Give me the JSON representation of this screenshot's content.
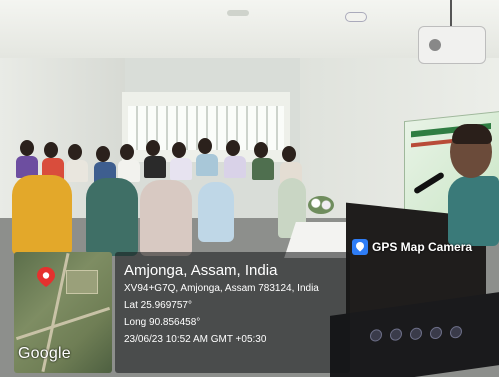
{
  "overlay": {
    "app_badge": "GPS Map Camera",
    "location_title": "Amjonga, Assam, India",
    "address": "XV94+G7Q, Amjonga, Assam 783124, India",
    "latitude": "Lat 25.969757°",
    "longitude": "Long 90.856458°",
    "timestamp": "23/06/23 10:52 AM GMT +05:30",
    "map_brand": "Google"
  },
  "colors": {
    "badge_icon": "#2e7df6",
    "pin": "#e5312e",
    "overlay_bg": "rgba(20,22,24,0.55)"
  },
  "icons": {
    "badge": "gps-map-camera-icon",
    "pin": "map-pin-icon"
  }
}
